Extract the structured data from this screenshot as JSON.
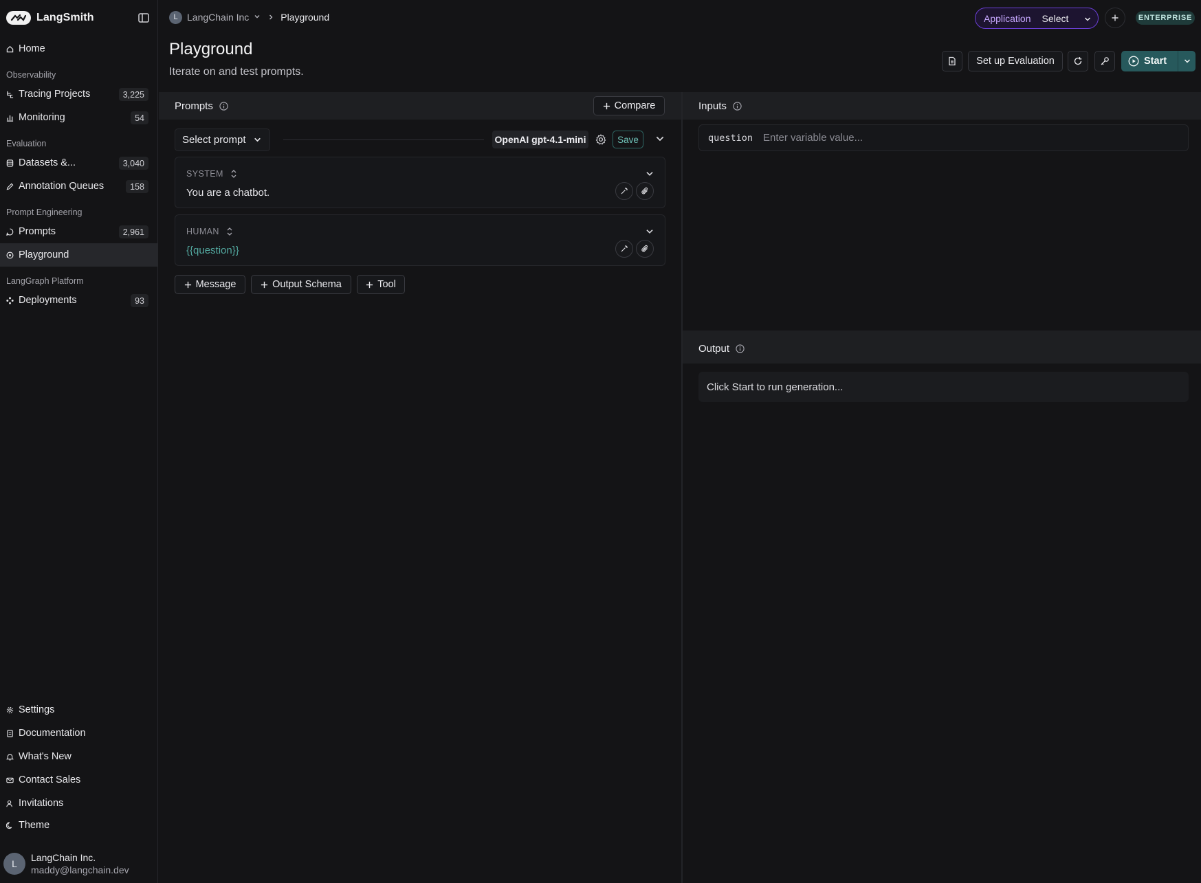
{
  "brand": {
    "name": "LangSmith",
    "logo_icon": "langchain-logo-icon"
  },
  "sidebar": {
    "home": {
      "label": "Home",
      "icon": "home-icon"
    },
    "sections": [
      {
        "title": "Observability",
        "items": [
          {
            "label": "Tracing Projects",
            "count": "3,225",
            "icon": "tracing-icon"
          },
          {
            "label": "Monitoring",
            "count": "54",
            "icon": "monitoring-icon"
          }
        ]
      },
      {
        "title": "Evaluation",
        "items": [
          {
            "label": "Datasets &...",
            "count": "3,040",
            "icon": "database-icon"
          },
          {
            "label": "Annotation Queues",
            "count": "158",
            "icon": "pencil-icon"
          }
        ]
      },
      {
        "title": "Prompt Engineering",
        "items": [
          {
            "label": "Prompts",
            "count": "2,961",
            "icon": "prompts-icon"
          },
          {
            "label": "Playground",
            "count": "",
            "icon": "playground-icon",
            "active": true
          }
        ]
      },
      {
        "title": "LangGraph Platform",
        "items": [
          {
            "label": "Deployments",
            "count": "93",
            "icon": "deployments-icon"
          }
        ]
      }
    ],
    "bottom": [
      {
        "label": "Settings",
        "icon": "gear-icon"
      },
      {
        "label": "Documentation",
        "icon": "document-icon"
      },
      {
        "label": "What's New",
        "icon": "bell-icon"
      },
      {
        "label": "Contact Sales",
        "icon": "mail-icon"
      },
      {
        "label": "Invitations",
        "icon": "user-icon"
      },
      {
        "label": "Theme",
        "icon": "moon-icon"
      }
    ],
    "user": {
      "initial": "L",
      "org": "LangChain Inc.",
      "email": "maddy@langchain.dev"
    }
  },
  "header": {
    "breadcrumb": {
      "org_initial": "L",
      "org": "LangChain Inc",
      "page": "Playground"
    },
    "application": {
      "label": "Application",
      "value": "Select"
    },
    "plan_badge": "ENTERPRISE",
    "title": "Playground",
    "subtitle": "Iterate on and test prompts.",
    "setup_eval_label": "Set up Evaluation",
    "start_label": "Start"
  },
  "prompts": {
    "title": "Prompts",
    "compare_label": "Compare",
    "select_prompt_label": "Select prompt",
    "model": "OpenAI gpt-4.1-mini",
    "save_label": "Save",
    "messages": [
      {
        "role": "SYSTEM",
        "text": "You are a chatbot."
      },
      {
        "role": "HUMAN",
        "text": "{{question}}"
      }
    ],
    "add_buttons": {
      "message": "Message",
      "output_schema": "Output Schema",
      "tool": "Tool"
    }
  },
  "inputs": {
    "title": "Inputs",
    "variables": [
      {
        "key": "question",
        "value": "",
        "placeholder": "Enter variable value..."
      }
    ]
  },
  "output": {
    "title": "Output",
    "placeholder": "Click Start to run generation..."
  },
  "colors": {
    "background": "#141416",
    "accent_teal": "#27595c",
    "application_purple": "#6b3fd6",
    "variable_teal": "#53a9a0"
  }
}
